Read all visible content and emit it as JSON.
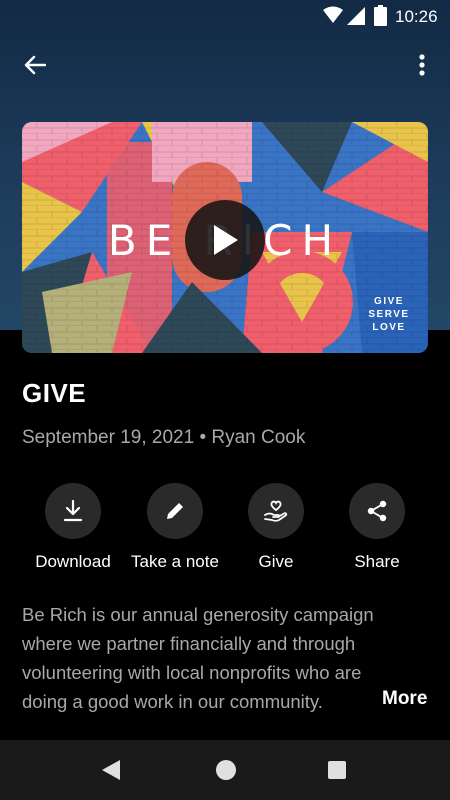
{
  "status_bar": {
    "time": "10:26",
    "icons": [
      "wifi-icon",
      "signal-icon",
      "battery-icon"
    ]
  },
  "app_bar": {
    "back_icon": "arrow-left-icon",
    "menu_icon": "more-vert-icon"
  },
  "media": {
    "artwork_title": "BE RICH",
    "artwork_tagline": [
      "GIVE",
      "SERVE",
      "LOVE"
    ],
    "play_icon": "play-icon"
  },
  "sermon": {
    "title": "GIVE",
    "meta": "September 19, 2021 • Ryan Cook",
    "description": "Be Rich is our annual generosity campaign where we partner financially and through volunteering with local nonprofits who are doing a good work in our community.",
    "more_label": "More"
  },
  "actions": [
    {
      "label": "Download",
      "icon": "download-icon"
    },
    {
      "label": "Take a note",
      "icon": "pencil-icon"
    },
    {
      "label": "Give",
      "icon": "hand-heart-icon"
    },
    {
      "label": "Share",
      "icon": "share-icon"
    }
  ],
  "nav_bar": {
    "icons": [
      "nav-back-icon",
      "nav-home-icon",
      "nav-recents-icon"
    ]
  },
  "colors": {
    "background": "#000000",
    "header_gradient_top": "#122a44",
    "header_gradient_bottom": "#234766",
    "action_circle": "#2a2a2a",
    "muted_text": "#a8a8a8",
    "nav_bar": "#1a1a1a"
  }
}
